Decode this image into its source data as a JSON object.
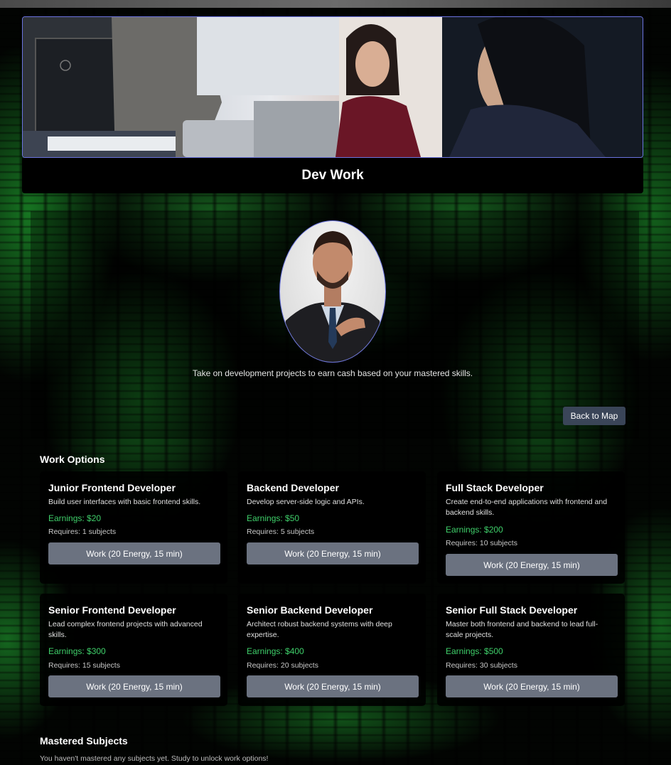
{
  "header": {
    "title": "Dev Work"
  },
  "intro": {
    "text": "Take on development projects to earn cash based on your mastered skills."
  },
  "nav": {
    "back_label": "Back to Map"
  },
  "work_options": {
    "title": "Work Options",
    "jobs": [
      {
        "title": "Junior Frontend Developer",
        "description": "Build user interfaces with basic frontend skills.",
        "earnings": "Earnings: $20",
        "requires": "Requires: 1 subjects",
        "button": "Work (20 Energy, 15 min)"
      },
      {
        "title": "Backend Developer",
        "description": "Develop server-side logic and APIs.",
        "earnings": "Earnings: $50",
        "requires": "Requires: 5 subjects",
        "button": "Work (20 Energy, 15 min)"
      },
      {
        "title": "Full Stack Developer",
        "description": "Create end-to-end applications with frontend and backend skills.",
        "earnings": "Earnings: $200",
        "requires": "Requires: 10 subjects",
        "button": "Work (20 Energy, 15 min)"
      },
      {
        "title": "Senior Frontend Developer",
        "description": "Lead complex frontend projects with advanced skills.",
        "earnings": "Earnings: $300",
        "requires": "Requires: 15 subjects",
        "button": "Work (20 Energy, 15 min)"
      },
      {
        "title": "Senior Backend Developer",
        "description": "Architect robust backend systems with deep expertise.",
        "earnings": "Earnings: $400",
        "requires": "Requires: 20 subjects",
        "button": "Work (20 Energy, 15 min)"
      },
      {
        "title": "Senior Full Stack Developer",
        "description": "Master both frontend and backend to lead full-scale projects.",
        "earnings": "Earnings: $500",
        "requires": "Requires: 30 subjects",
        "button": "Work (20 Energy, 15 min)"
      }
    ]
  },
  "mastered": {
    "title": "Mastered Subjects",
    "empty_text": "You haven't mastered any subjects yet. Study to unlock work options!"
  },
  "colors": {
    "accent_border": "#6b74e0",
    "earnings": "#3fcf6a",
    "button": "#6b7280",
    "back_button": "#3a4558"
  }
}
